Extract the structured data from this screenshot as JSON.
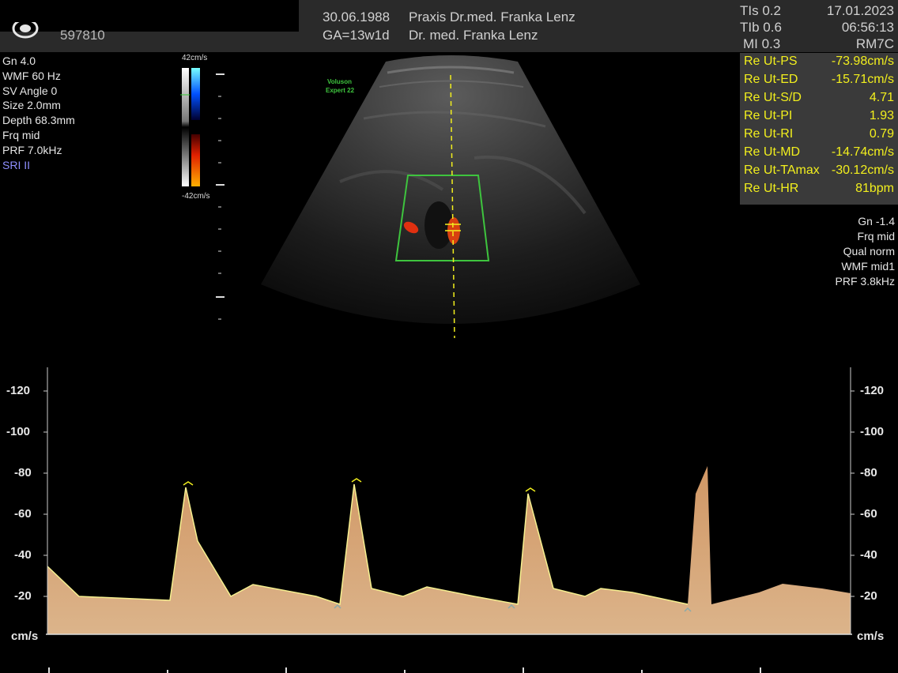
{
  "header": {
    "patient_id": "597810",
    "dob": "30.06.1988",
    "ga": "GA=13w1d",
    "practice": "Praxis Dr.med. Franka Lenz",
    "doctor": "Dr. med. Franka Lenz",
    "tis": "TIs  0.2",
    "tib": "TIb  0.6",
    "mi": "MI  0.3",
    "date": "17.01.2023",
    "time": "06:56:13",
    "probe": "RM7C"
  },
  "left_params": [
    "Gn  4.0",
    "WMF 60 Hz",
    "SV Angle  0",
    "Size  2.0mm",
    "Depth 68.3mm",
    "Frq mid",
    "PRF  7.0kHz"
  ],
  "sri": "SRI II",
  "color_bar": {
    "top": "42cm/s",
    "bottom": "-42cm/s"
  },
  "image": {
    "brand": "Voluson",
    "model": "Expert 22"
  },
  "measurements": [
    {
      "label": "Re Ut-PS",
      "value": "-73.98cm/s"
    },
    {
      "label": "Re Ut-ED",
      "value": "-15.71cm/s"
    },
    {
      "label": "Re Ut-S/D",
      "value": "4.71"
    },
    {
      "label": "Re Ut-PI",
      "value": "1.93"
    },
    {
      "label": "Re Ut-RI",
      "value": "0.79"
    },
    {
      "label": "Re Ut-MD",
      "value": "-14.74cm/s"
    },
    {
      "label": "Re Ut-TAmax",
      "value": "-30.12cm/s"
    },
    {
      "label": "Re Ut-HR",
      "value": "81bpm"
    }
  ],
  "right_params": [
    "Gn -1.4",
    "Frq mid",
    "Qual norm",
    "WMF mid1",
    "PRF  3.8kHz"
  ],
  "spectrum": {
    "axis_ticks": [
      "-120",
      "-100",
      "-80",
      "-60",
      "-40",
      "-20"
    ],
    "unit": "cm/s"
  },
  "colors": {
    "measure_text": "#f2ef1d",
    "measure_bg": "#3a3a3a",
    "roi": "#3ec43e",
    "spectral": "#e8a870"
  }
}
